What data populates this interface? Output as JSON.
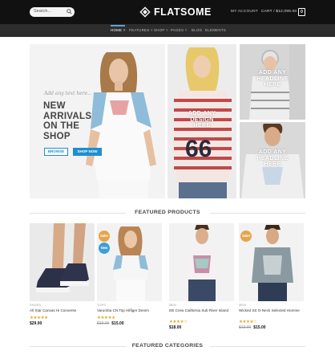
{
  "header": {
    "search_placeholder": "Search...",
    "logo_text": "FLATSOME",
    "my_account": "MY ACCOUNT",
    "cart_label": "CART / $12,099.00",
    "cart_count": "0"
  },
  "nav": {
    "items": [
      {
        "label": "HOME ˅"
      },
      {
        "label": "FEATURES ˅"
      },
      {
        "label": "SHOP ˅"
      },
      {
        "label": "PAGES ˅"
      },
      {
        "label": "BLOG"
      },
      {
        "label": "ELEMENTS"
      }
    ]
  },
  "hero": {
    "script_text": "Add any text here...",
    "title_line1": "NEW",
    "title_line2": "ARRIVALS",
    "title_line3": "ON THE",
    "title_line4": "SHOP",
    "browse_label": "BROWSE",
    "shop_now_label": "SHOP NOW"
  },
  "banners": {
    "b2_line1": "ADD ANY",
    "b2_line2": "DESIGN",
    "b2_line3": "HERE",
    "b3_line1": "ADD ANY",
    "b3_line2": "HEADLINE",
    "b3_line3": "HERE",
    "b4_line1": "ADD ANY",
    "b4_line2": "HEADLINE",
    "b4_line3": "HERE"
  },
  "featured_products_title": "FEATURED PRODUCTS",
  "featured_categories_title": "FEATURED CATEGORIES",
  "colors": {
    "accent_blue": "#1e8fd0",
    "badge_orange": "#e5a54b",
    "badge_blue": "#3f9fd1",
    "star": "#e9a825"
  },
  "products": [
    {
      "category": "SHOES",
      "name": "All Star Canvas Hi Converse",
      "stars": "★★★★★",
      "old_price": "",
      "price": "$29.00",
      "badge": ""
    },
    {
      "category": "TOPS",
      "name": "Varumba CN Top Hilfiger Denim",
      "stars": "★★★★★",
      "old_price": "$19.00",
      "price": "$15.00",
      "badge": "Sale!",
      "badge2": "New"
    },
    {
      "category": "MEN",
      "name": "DE Crew California Sub River Island",
      "stars": "★★★★☆",
      "old_price": "",
      "price": "$18.00",
      "badge": ""
    },
    {
      "category": "MEN",
      "name": "Wicked SS O-Neck Selected Homme",
      "stars": "★★★★☆",
      "old_price": "$13.00",
      "price": "$15.00",
      "badge": "Sale!"
    }
  ]
}
